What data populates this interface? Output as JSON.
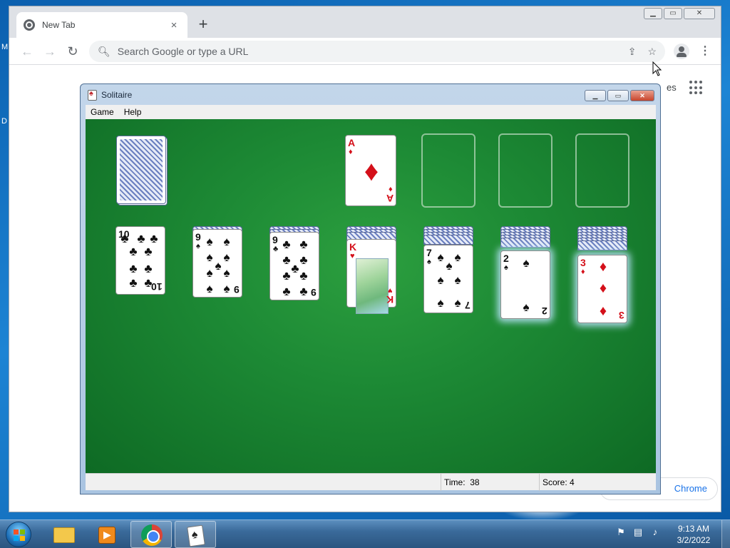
{
  "desktop": {
    "edge_letter_1": "M",
    "edge_letter_2": "D"
  },
  "browser": {
    "tab_title": "New Tab",
    "tab_close_icon": "×",
    "new_tab_icon": "+",
    "window_controls": {
      "minimize": "▁",
      "maximize": "▭",
      "close": "✕"
    },
    "back_icon": "←",
    "forward_icon": "→",
    "reload_icon": "↻",
    "omnibox_placeholder": "Search Google or type a URL",
    "share_icon": "⇪",
    "bookmark_icon": "☆",
    "menu_icon": "⋮",
    "ntp_images_partial": "es",
    "customize_partial": "Chrome"
  },
  "solitaire": {
    "title": "Solitaire",
    "menus": [
      "Game",
      "Help"
    ],
    "controls": {
      "minimize": "▁",
      "maximize": "▭",
      "close": "✕"
    },
    "status": {
      "time_label": "Time:",
      "time_value": "38",
      "score_label": "Score:",
      "score_value": "4"
    },
    "foundations": [
      {
        "rank": "A",
        "suit": "diamonds"
      },
      {
        "rank": "",
        "suit": "empty"
      },
      {
        "rank": "",
        "suit": "empty"
      },
      {
        "rank": "",
        "suit": "empty"
      }
    ],
    "tableau": [
      {
        "face_down": 0,
        "top_card": {
          "rank": "10",
          "suit": "clubs"
        }
      },
      {
        "face_down": 1,
        "top_card": {
          "rank": "9",
          "suit": "spades"
        }
      },
      {
        "face_down": 2,
        "top_card": {
          "rank": "9",
          "suit": "clubs"
        }
      },
      {
        "face_down": 3,
        "top_card": {
          "rank": "K",
          "suit": "hearts"
        }
      },
      {
        "face_down": 4,
        "top_card": {
          "rank": "7",
          "suit": "spades"
        }
      },
      {
        "face_down": 5,
        "top_card": {
          "rank": "2",
          "suit": "spades"
        }
      },
      {
        "face_down": 6,
        "top_card": {
          "rank": "3",
          "suit": "diamonds"
        }
      }
    ]
  },
  "taskbar": {
    "clock_time": "9:13 AM",
    "clock_date": "3/2/2022",
    "items": [
      "start-button",
      "file-explorer",
      "media-player",
      "google-chrome",
      "solitaire"
    ]
  },
  "colors": {
    "felt": "#1d8a35",
    "red_suit": "#d4101a",
    "black_suit": "#111111",
    "taskbar": "#3a6a9a"
  }
}
